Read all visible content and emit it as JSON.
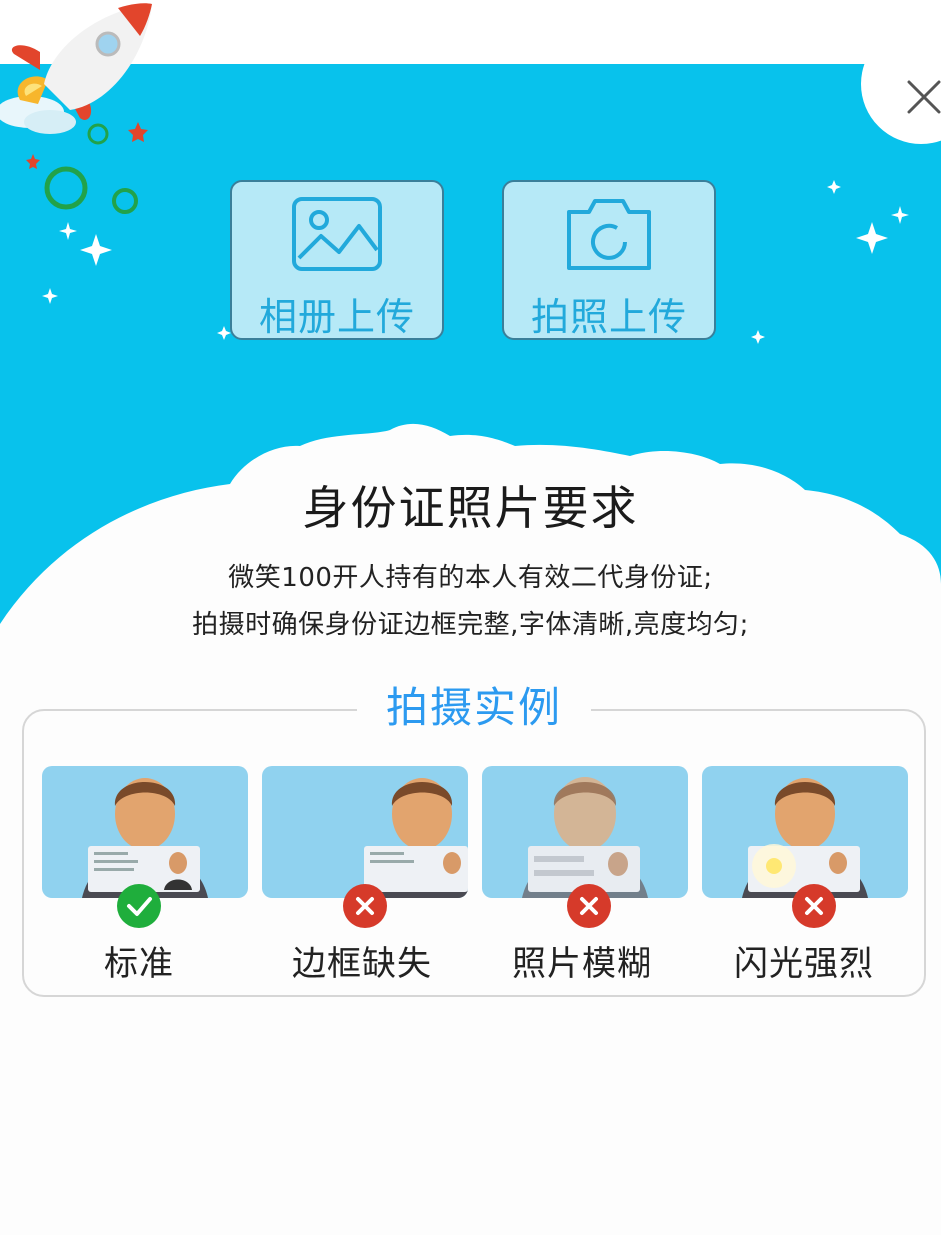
{
  "upload": {
    "album_label": "相册上传",
    "camera_label": "拍照上传"
  },
  "requirements": {
    "title": "身份证照片要求",
    "line1": "微笑100开人持有的本人有效二代身份证;",
    "line2": "拍摄时确保身份证边框完整,字体清晰,亮度均匀;"
  },
  "examples": {
    "title": "拍摄实例",
    "items": [
      {
        "caption": "标准",
        "status": "ok"
      },
      {
        "caption": "边框缺失",
        "status": "bad"
      },
      {
        "caption": "照片模糊",
        "status": "bad"
      },
      {
        "caption": "闪光强烈",
        "status": "bad"
      }
    ]
  },
  "colors": {
    "sky": "#08c2ec",
    "accent": "#2c9af0",
    "ok": "#1fae3c",
    "bad": "#d63a2a"
  },
  "icons": [
    "close-icon",
    "image-icon",
    "camera-icon",
    "check-icon",
    "cross-icon",
    "rocket-icon"
  ]
}
